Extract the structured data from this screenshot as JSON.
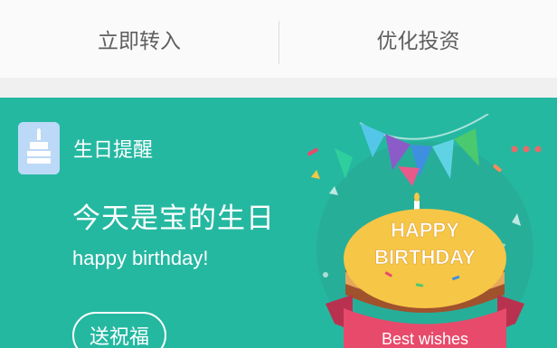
{
  "topbar": {
    "left_tab": "立即转入",
    "right_tab": "优化投资"
  },
  "card": {
    "app_title": "生日提醒",
    "headline": "今天是宝的生日",
    "subline": "happy birthday!",
    "bless_button": "送祝福",
    "cake_text_line1": "HAPPY",
    "cake_text_line2": "BIRTHDAY",
    "ribbon_text": "Best wishes",
    "colors": {
      "card_bg": "#25b8a1",
      "cake_top": "#f6c646",
      "ribbon": "#e84a6b"
    }
  },
  "icons": {
    "app_icon": "birthday-cake-icon",
    "more": "more-dots-icon"
  }
}
